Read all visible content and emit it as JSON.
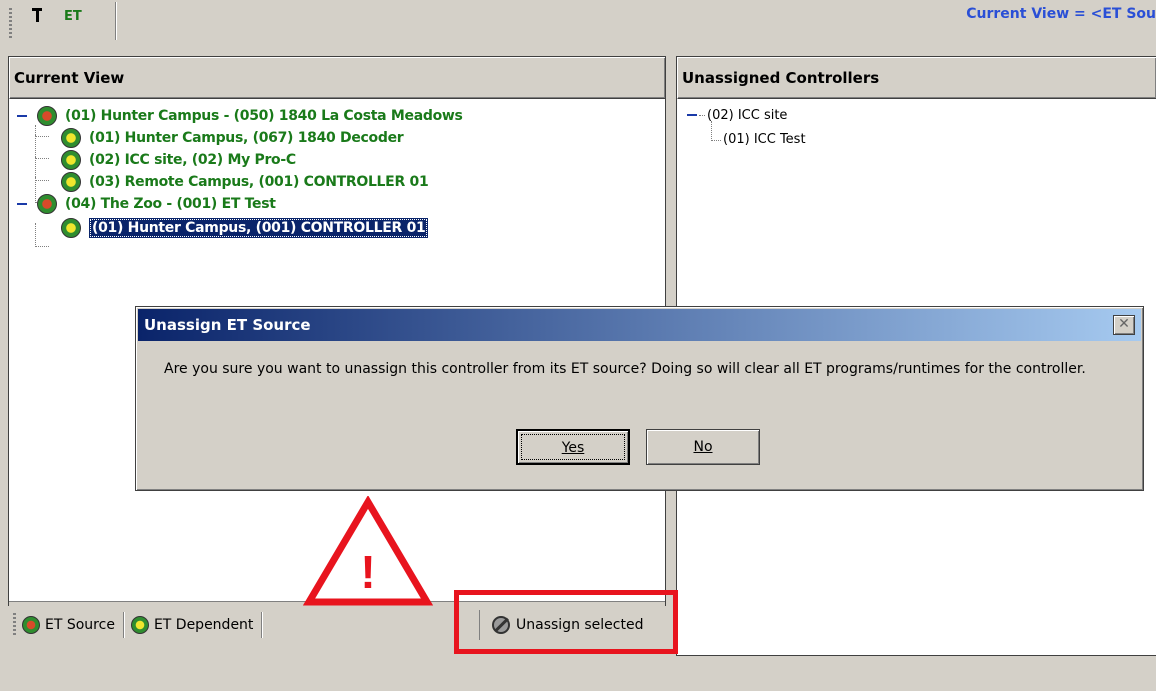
{
  "toolbar": {
    "et_button_label": "ET",
    "et_button_icon": "et-tool-icon",
    "current_view_text": "Current View = <ET Sou"
  },
  "left_panel": {
    "header": "Current View",
    "tree": [
      {
        "label": "(01) Hunter Campus - (050) 1840 La Costa Meadows",
        "type": "source",
        "icon": "red-dot-icon"
      },
      {
        "label": "(01) Hunter Campus, (067) 1840 Decoder",
        "type": "dependent",
        "icon": "yellow-dot-icon"
      },
      {
        "label": "(02) ICC site, (02) My Pro-C",
        "type": "dependent",
        "icon": "yellow-dot-icon"
      },
      {
        "label": "(03) Remote Campus, (001) CONTROLLER 01",
        "type": "dependent",
        "icon": "yellow-dot-icon"
      },
      {
        "label": "(04) The Zoo - (001) ET Test",
        "type": "source",
        "icon": "red-dot-icon"
      },
      {
        "label": "(01) Hunter Campus, (001) CONTROLLER 01",
        "type": "dependent",
        "icon": "yellow-dot-icon",
        "selected": true
      }
    ]
  },
  "right_panel": {
    "header": "Unassigned Controllers",
    "tree": [
      {
        "label": "(02) ICC site"
      },
      {
        "label": "(01) ICC Test"
      }
    ]
  },
  "bottom_bar": {
    "legend_source": "ET Source",
    "legend_dependent": "ET Dependent",
    "unassign_label": "Unassign selected"
  },
  "warning": {
    "symbol": "!"
  },
  "dialog": {
    "title": "Unassign ET Source",
    "close_symbol": "✕",
    "message": "Are you sure you want to unassign this controller from its ET source?  Doing so will clear all ET programs/runtimes for the controller.",
    "yes_label": "Yes",
    "no_label": "No"
  },
  "colors": {
    "tree_text": "#1a7a1a",
    "selection_bg": "#0a246a",
    "current_view_text": "#2a4fd6",
    "highlight": "#e8141e",
    "title_bar_start": "#0a246a",
    "title_bar_end": "#a6caf0"
  }
}
